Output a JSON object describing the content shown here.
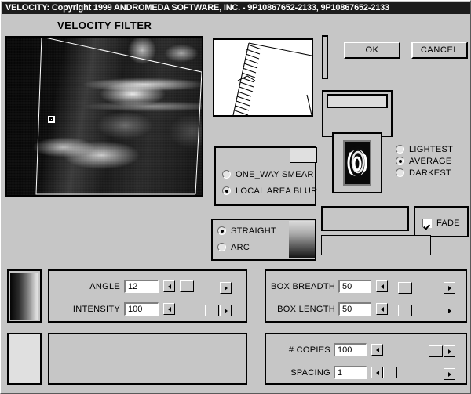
{
  "window": {
    "title": "VELOCITY: Copyright 1999 ANDROMEDA SOFTWARE, INC. - 9P10867652-2133, 9P10867652-2133",
    "heading": "VELOCITY FILTER"
  },
  "buttons": {
    "ok": "OK",
    "cancel": "CANCEL"
  },
  "blend_mode": {
    "options": [
      "LIGHTEST",
      "AVERAGE",
      "DARKEST"
    ],
    "selected": "AVERAGE"
  },
  "fade": {
    "label": "FADE",
    "checked": true
  },
  "smear_mode": {
    "options": [
      "ONE_WAY SMEAR",
      "LOCAL AREA BLUR"
    ],
    "selected": "LOCAL AREA BLUR"
  },
  "path_mode": {
    "options": [
      "STRAIGHT",
      "ARC"
    ],
    "selected": "STRAIGHT"
  },
  "sliders": {
    "angle": {
      "label": "ANGLE",
      "value": "12",
      "thumb_pct": 8
    },
    "intensity": {
      "label": "INTENSITY",
      "value": "100",
      "thumb_pct": 92
    },
    "box_breadth": {
      "label": "BOX BREADTH",
      "value": "50",
      "thumb_pct": 50
    },
    "box_length": {
      "label": "BOX LENGTH",
      "value": "50",
      "thumb_pct": 50
    },
    "copies": {
      "label": "# COPIES",
      "value": "100",
      "thumb_pct": 90
    },
    "spacing": {
      "label": "SPACING",
      "value": "1",
      "thumb_pct": 4
    }
  },
  "colors": {
    "face": "#c6c6c6",
    "titlebar": "#1c1c1c",
    "titlebar_text": "#ffffff",
    "field_bg": "#ffffff",
    "shadow": "#808080",
    "highlight": "#ffffff"
  },
  "icons": {
    "left_arrow": "scroll-left-arrow",
    "right_arrow": "scroll-right-arrow",
    "radio": "radio-button",
    "checkbox": "checkbox"
  }
}
